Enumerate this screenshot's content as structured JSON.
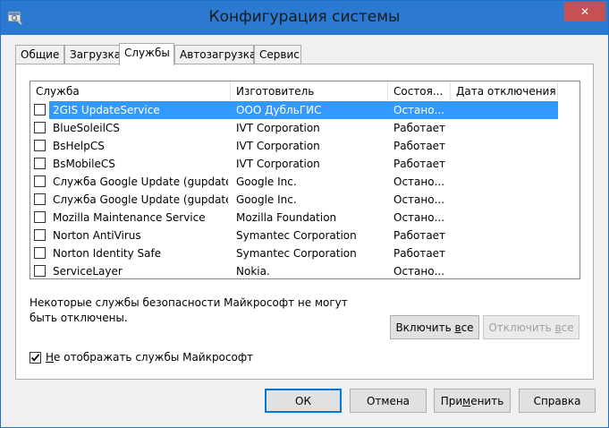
{
  "window": {
    "title": "Конфигурация системы",
    "close_glyph": "✕"
  },
  "tabs": [
    {
      "label": "Общие",
      "active": false
    },
    {
      "label": "Загрузка",
      "active": false
    },
    {
      "label": "Службы",
      "active": true
    },
    {
      "label": "Автозагрузка",
      "active": false
    },
    {
      "label": "Сервис",
      "active": false
    }
  ],
  "services": {
    "columns": {
      "service": "Служба",
      "manufacturer": "Изготовитель",
      "status": "Состоя...",
      "disabled_date": "Дата отключения"
    },
    "rows": [
      {
        "name": "2GIS UpdateService",
        "manufacturer": "ООО ДубльГИС",
        "status": "Остано...",
        "date": "",
        "checked": false,
        "selected": true
      },
      {
        "name": "BlueSoleilCS",
        "manufacturer": "IVT Corporation",
        "status": "Работает",
        "date": "",
        "checked": false,
        "selected": false
      },
      {
        "name": "BsHelpCS",
        "manufacturer": "IVT Corporation",
        "status": "Работает",
        "date": "",
        "checked": false,
        "selected": false
      },
      {
        "name": "BsMobileCS",
        "manufacturer": "IVT Corporation",
        "status": "Работает",
        "date": "",
        "checked": false,
        "selected": false
      },
      {
        "name": "Служба Google Update (gupdate)",
        "manufacturer": "Google Inc.",
        "status": "Остано...",
        "date": "",
        "checked": false,
        "selected": false
      },
      {
        "name": "Служба Google Update (gupdate...",
        "manufacturer": "Google Inc.",
        "status": "Остано...",
        "date": "",
        "checked": false,
        "selected": false
      },
      {
        "name": "Mozilla Maintenance Service",
        "manufacturer": "Mozilla Foundation",
        "status": "Остано...",
        "date": "",
        "checked": false,
        "selected": false
      },
      {
        "name": "Norton AntiVirus",
        "manufacturer": "Symantec Corporation",
        "status": "Работает",
        "date": "",
        "checked": false,
        "selected": false
      },
      {
        "name": "Norton Identity Safe",
        "manufacturer": "Symantec Corporation",
        "status": "Работает",
        "date": "",
        "checked": false,
        "selected": false
      },
      {
        "name": "ServiceLayer",
        "manufacturer": "Nokia.",
        "status": "Остано...",
        "date": "",
        "checked": false,
        "selected": false
      }
    ]
  },
  "note": "Некоторые службы безопасности Майкрософт не могут быть отключены.",
  "buttons": {
    "enable_all_pre": "Включить ",
    "enable_all_u": "в",
    "enable_all_post": "се",
    "disable_all_pre": "Отключить ",
    "disable_all_u": "в",
    "disable_all_post": "се",
    "ok": "ОК",
    "cancel": "Отмена",
    "apply_pre": "При",
    "apply_u": "м",
    "apply_post": "енить",
    "help": "Справка"
  },
  "hide_ms": {
    "checked": true,
    "label_u": "Н",
    "label_rest": "е отображать службы Майкрософт"
  },
  "colors": {
    "titlebar": "#2b79d0",
    "selection": "#3399ff",
    "close": "#c75050"
  }
}
